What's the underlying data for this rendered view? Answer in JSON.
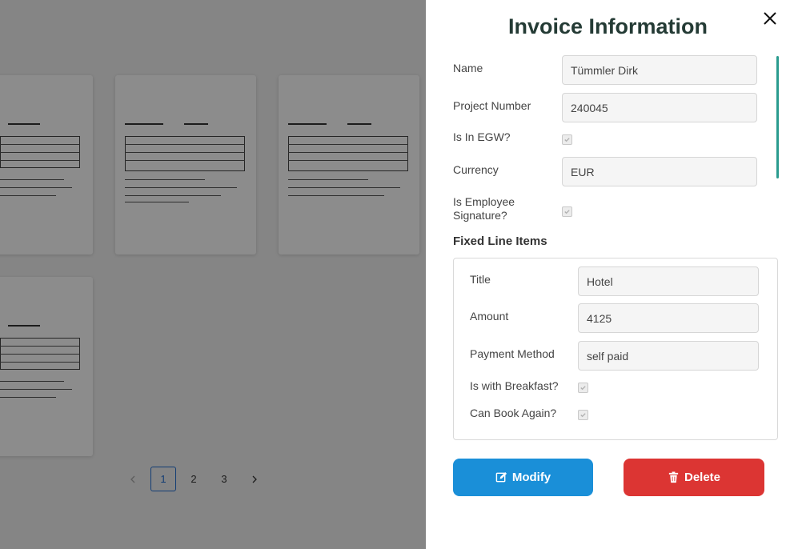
{
  "drawer": {
    "title": "Invoice Information",
    "fields": {
      "name_label": "Name",
      "name_value": "Tümmler Dirk",
      "project_label": "Project Number",
      "project_value": "240045",
      "egw_label": "Is In EGW?",
      "egw_checked": true,
      "currency_label": "Currency",
      "currency_value": "EUR",
      "signature_label": "Is Employee Signature?",
      "signature_checked": true
    },
    "fixed_line_items": {
      "heading": "Fixed Line Items",
      "title_label": "Title",
      "title_value": "Hotel",
      "amount_label": "Amount",
      "amount_value": "4125",
      "payment_label": "Payment Method",
      "payment_value": "self paid",
      "breakfast_label": "Is with Breakfast?",
      "breakfast_checked": true,
      "book_again_label": "Can Book Again?",
      "book_again_checked": true
    },
    "actions": {
      "modify_label": "Modify",
      "delete_label": "Delete"
    }
  },
  "pagination": {
    "pages": [
      "1",
      "2",
      "3"
    ],
    "current": "1"
  },
  "colors": {
    "modify": "#1a8fd8",
    "delete": "#dc3533",
    "title": "#243b35",
    "accent_scroll": "#2a9c8f"
  }
}
